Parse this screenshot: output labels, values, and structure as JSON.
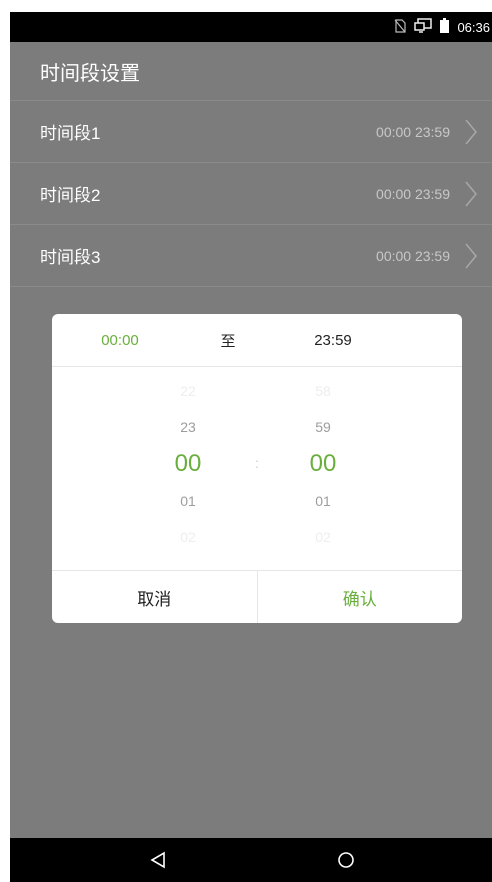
{
  "status_bar": {
    "time": "06:36",
    "icons": [
      "no-sim-icon",
      "screen-cast-icon",
      "battery-icon"
    ]
  },
  "header": {
    "title": "时间段设置"
  },
  "periods": [
    {
      "label": "时间段1",
      "range": "00:00 23:59"
    },
    {
      "label": "时间段2",
      "range": "00:00 23:59"
    },
    {
      "label": "时间段3",
      "range": "00:00 23:59"
    }
  ],
  "dialog": {
    "start_time": "00:00",
    "separator": "至",
    "end_time": "23:59",
    "hour_column": [
      "22",
      "23",
      "00",
      "01",
      "02"
    ],
    "minute_column": [
      "58",
      "59",
      "00",
      "01",
      "02"
    ],
    "colon": ":",
    "cancel_label": "取消",
    "confirm_label": "确认"
  },
  "colors": {
    "accent": "#6aaf3d",
    "dim_background": "#7c7c7c",
    "bar": "#000000"
  },
  "nav_bar": {
    "icons": [
      "back-icon",
      "home-icon"
    ]
  }
}
